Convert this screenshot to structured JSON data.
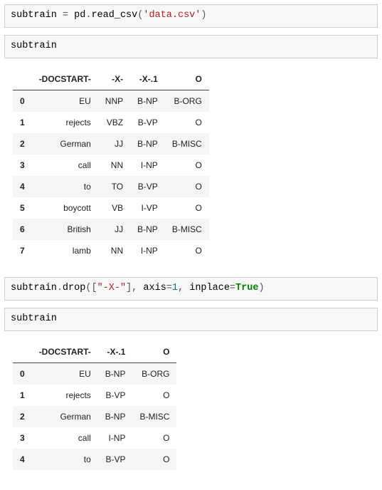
{
  "cells": {
    "code1": {
      "var1": "subtrain",
      "eq": " = ",
      "mod": "pd",
      "dot1": ".",
      "func": "read_csv",
      "paren_open": "(",
      "quote_open": "'",
      "str": "data.csv",
      "quote_close": "'",
      "paren_close": ")"
    },
    "code2": {
      "expr": "subtrain"
    },
    "code3": {
      "var": "subtrain",
      "dot": ".",
      "func": "drop",
      "paren_open": "(",
      "brack_open": "[",
      "q1": "\"",
      "str": "-X-",
      "q2": "\"",
      "brack_close": "],",
      "sp1": " ",
      "arg1": "axis",
      "eq1": "=",
      "num1": "1",
      "comma": ",",
      "sp2": " ",
      "arg2": "inplace",
      "eq2": "=",
      "kw": "True",
      "paren_close": ")"
    },
    "code4": {
      "expr": "subtrain"
    }
  },
  "table1": {
    "columns": [
      "-DOCSTART-",
      "-X-",
      "-X-.1",
      "O"
    ],
    "rows": [
      {
        "idx": "0",
        "c0": "EU",
        "c1": "NNP",
        "c2": "B-NP",
        "c3": "B-ORG"
      },
      {
        "idx": "1",
        "c0": "rejects",
        "c1": "VBZ",
        "c2": "B-VP",
        "c3": "O"
      },
      {
        "idx": "2",
        "c0": "German",
        "c1": "JJ",
        "c2": "B-NP",
        "c3": "B-MISC"
      },
      {
        "idx": "3",
        "c0": "call",
        "c1": "NN",
        "c2": "I-NP",
        "c3": "O"
      },
      {
        "idx": "4",
        "c0": "to",
        "c1": "TO",
        "c2": "B-VP",
        "c3": "O"
      },
      {
        "idx": "5",
        "c0": "boycott",
        "c1": "VB",
        "c2": "I-VP",
        "c3": "O"
      },
      {
        "idx": "6",
        "c0": "British",
        "c1": "JJ",
        "c2": "B-NP",
        "c3": "B-MISC"
      },
      {
        "idx": "7",
        "c0": "lamb",
        "c1": "NN",
        "c2": "I-NP",
        "c3": "O"
      }
    ]
  },
  "table2": {
    "columns": [
      "-DOCSTART-",
      "-X-.1",
      "O"
    ],
    "rows": [
      {
        "idx": "0",
        "c0": "EU",
        "c1": "B-NP",
        "c2": "B-ORG"
      },
      {
        "idx": "1",
        "c0": "rejects",
        "c1": "B-VP",
        "c2": "O"
      },
      {
        "idx": "2",
        "c0": "German",
        "c1": "B-NP",
        "c2": "B-MISC"
      },
      {
        "idx": "3",
        "c0": "call",
        "c1": "I-NP",
        "c2": "O"
      },
      {
        "idx": "4",
        "c0": "to",
        "c1": "B-VP",
        "c2": "O"
      }
    ]
  }
}
